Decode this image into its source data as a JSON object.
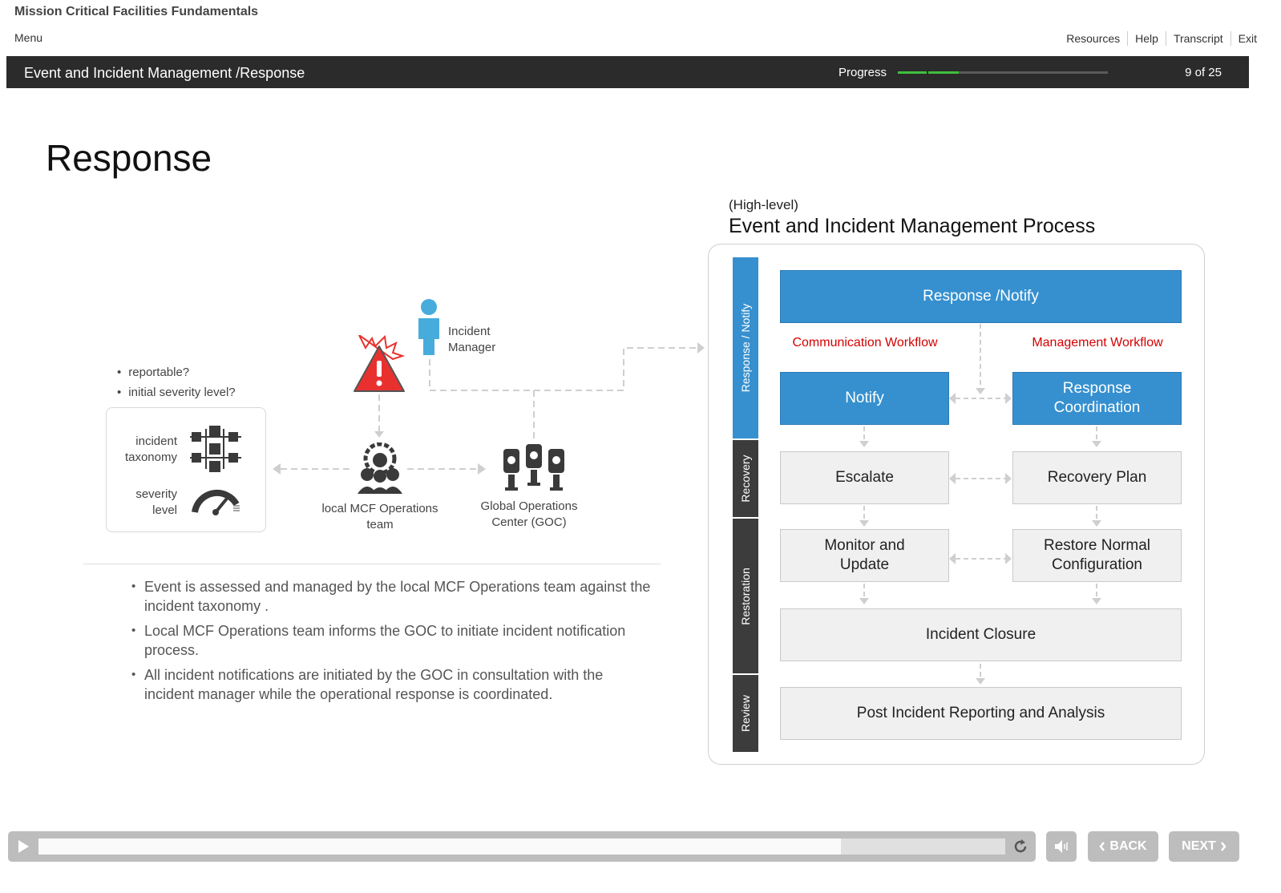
{
  "header": {
    "course_title": "Mission Critical Facilities Fundamentals",
    "menu": "Menu",
    "links": [
      "Resources",
      "Help",
      "Transcript",
      "Exit"
    ]
  },
  "topbar": {
    "breadcrumb": "Event and Incident Management /Response",
    "progress_label": "Progress",
    "progress_fraction": 0.29,
    "page_count": "9 of 25"
  },
  "page_title": "Response",
  "diagram": {
    "questions": [
      "reportable?",
      "initial severity level?"
    ],
    "incident_taxonomy": "incident taxonomy",
    "severity_level": "severity level",
    "incident_manager": "Incident Manager",
    "local_team": "local MCF Operations team",
    "goc": "Global Operations Center (GOC)"
  },
  "bullets": [
    "Event is assessed and managed by the local MCF Operations team against the incident taxonomy .",
    "Local MCF Operations team informs the GOC to initiate incident notification process.",
    "All incident notifications are initiated by the GOC in consultation with the incident manager while the operational response is coordinated."
  ],
  "process": {
    "subtitle": "(High-level)",
    "title": "Event and Incident Management Process",
    "phases": [
      "Response / Notify",
      "Recovery",
      "Restoration",
      "Review"
    ],
    "response_notify": "Response /Notify",
    "comm_workflow": "Communication Workflow",
    "mgmt_workflow": "Management Workflow",
    "notify": "Notify",
    "response_coordination": "Response Coordination",
    "escalate": "Escalate",
    "recovery_plan": "Recovery Plan",
    "monitor_update": "Monitor and Update",
    "restore_config": "Restore Normal Configuration",
    "incident_closure": "Incident Closure",
    "post_incident": "Post Incident Reporting and Analysis"
  },
  "player": {
    "seek_fraction": 0.83,
    "back": "BACK",
    "next": "NEXT"
  },
  "colors": {
    "accent_blue": "#3690cf",
    "progress_green": "#3fbf3f",
    "workflow_red": "#d40000",
    "alert_red": "#e8312f",
    "person_blue": "#47acdc"
  }
}
